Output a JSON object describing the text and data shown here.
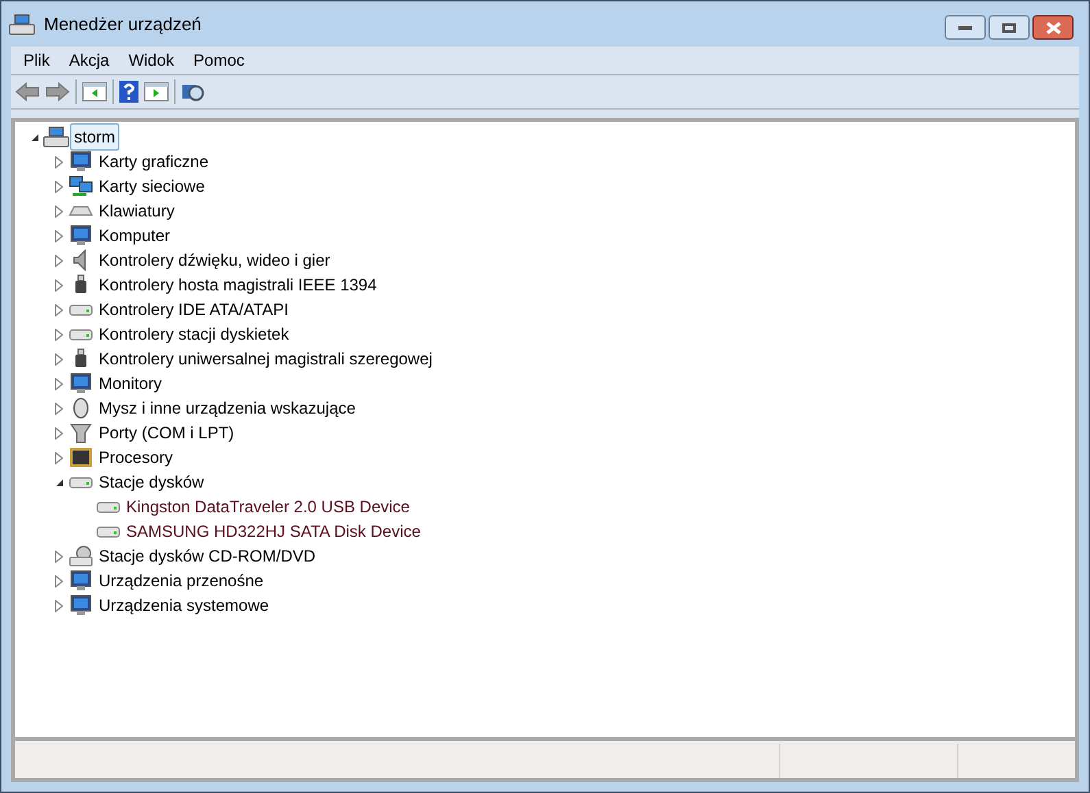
{
  "window": {
    "title": "Menedżer urządzeń"
  },
  "menu": [
    "Plik",
    "Akcja",
    "Widok",
    "Pomoc"
  ],
  "tree": {
    "label": "storm",
    "expanded": true,
    "selected": true,
    "children": [
      {
        "label": "Karty graficzne",
        "expanded": false
      },
      {
        "label": "Karty sieciowe",
        "expanded": false
      },
      {
        "label": "Klawiatury",
        "expanded": false
      },
      {
        "label": "Komputer",
        "expanded": false
      },
      {
        "label": "Kontrolery dźwięku, wideo i gier",
        "expanded": false
      },
      {
        "label": "Kontrolery hosta magistrali IEEE 1394",
        "expanded": false
      },
      {
        "label": "Kontrolery IDE ATA/ATAPI",
        "expanded": false
      },
      {
        "label": "Kontrolery stacji dyskietek",
        "expanded": false
      },
      {
        "label": "Kontrolery uniwersalnej magistrali szeregowej",
        "expanded": false
      },
      {
        "label": "Monitory",
        "expanded": false
      },
      {
        "label": "Mysz i inne urządzenia wskazujące",
        "expanded": false
      },
      {
        "label": "Porty (COM i LPT)",
        "expanded": false
      },
      {
        "label": "Procesory",
        "expanded": false
      },
      {
        "label": "Stacje dysków",
        "expanded": true,
        "children": [
          {
            "label": "Kingston DataTraveler 2.0 USB Device"
          },
          {
            "label": "SAMSUNG HD322HJ SATA Disk Device"
          }
        ]
      },
      {
        "label": "Stacje dysków CD-ROM/DVD",
        "expanded": false
      },
      {
        "label": "Urządzenia przenośne",
        "expanded": false
      },
      {
        "label": "Urządzenia systemowe",
        "expanded": false
      }
    ]
  }
}
